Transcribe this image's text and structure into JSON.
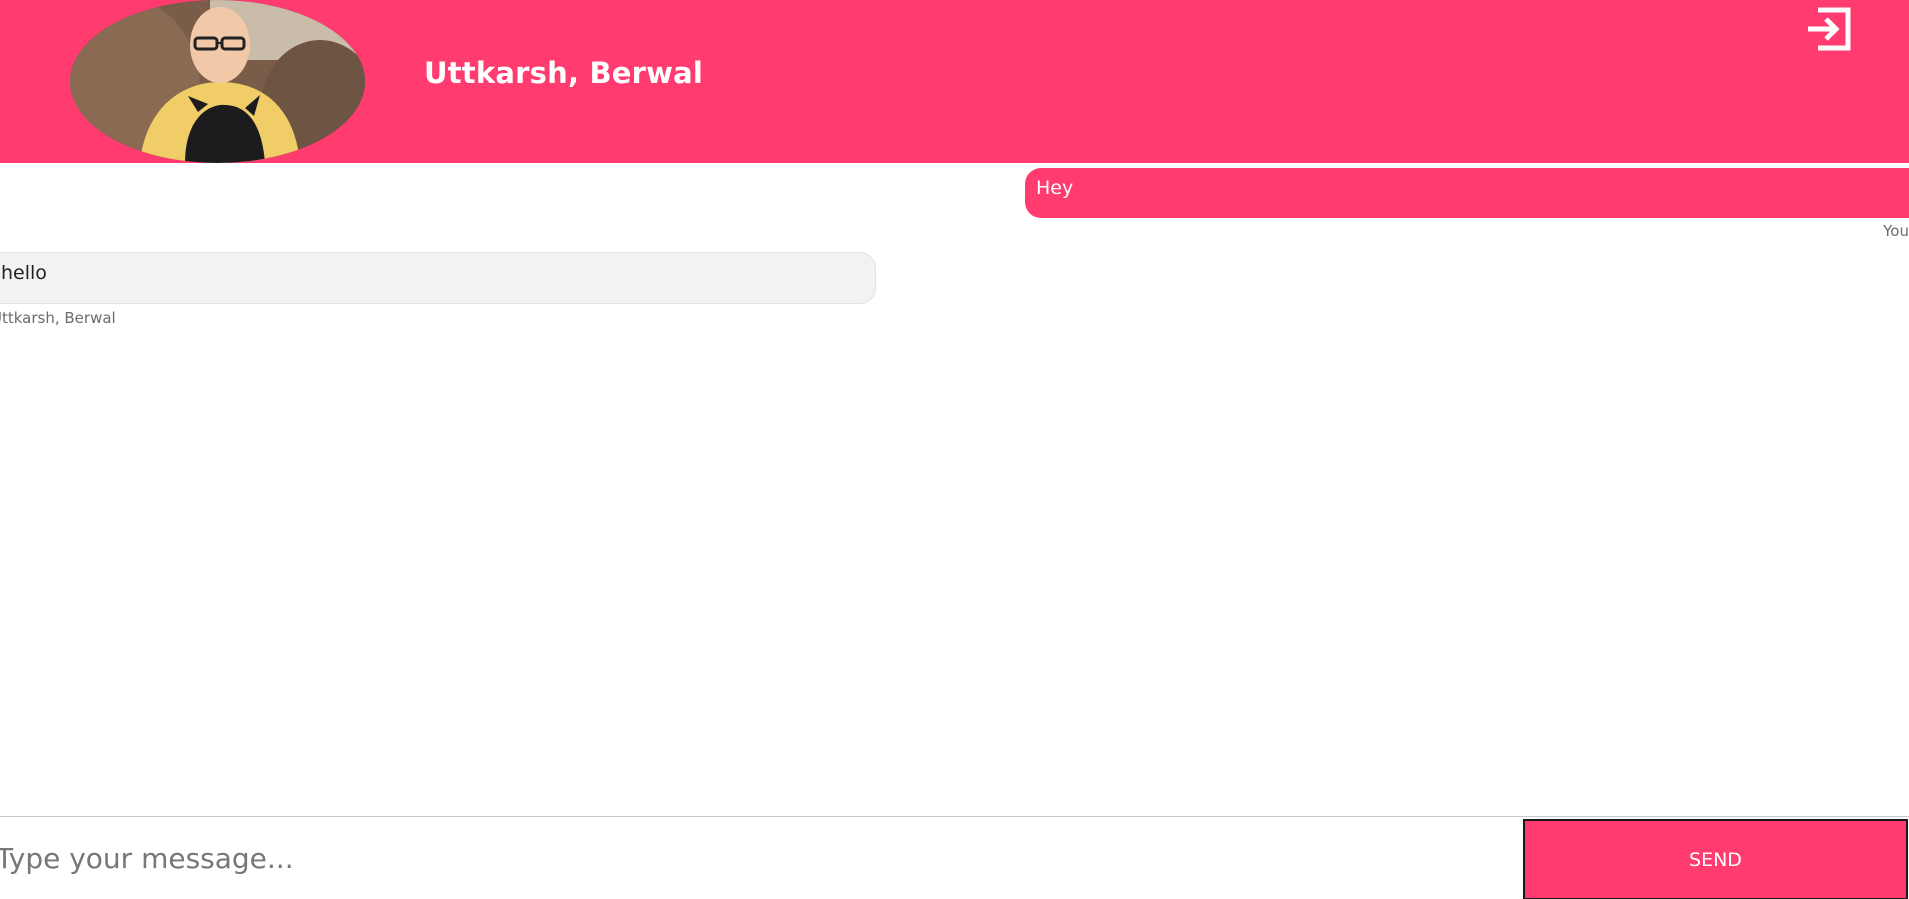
{
  "header": {
    "contact_name": "Uttkarsh, Berwal",
    "avatar": "contact-photo",
    "logout_icon": "logout-icon"
  },
  "messages": [
    {
      "direction": "outgoing",
      "text": "Hey",
      "sender": "You"
    },
    {
      "direction": "incoming",
      "text": "hello",
      "sender": "Uttkarsh, Berwal"
    }
  ],
  "composer": {
    "placeholder": "Type your message...",
    "value": "",
    "send_label": "SEND"
  },
  "colors": {
    "accent": "#ff3b6f",
    "incoming_bubble": "#f2f2f2",
    "meta_text": "#6b6b6b"
  }
}
